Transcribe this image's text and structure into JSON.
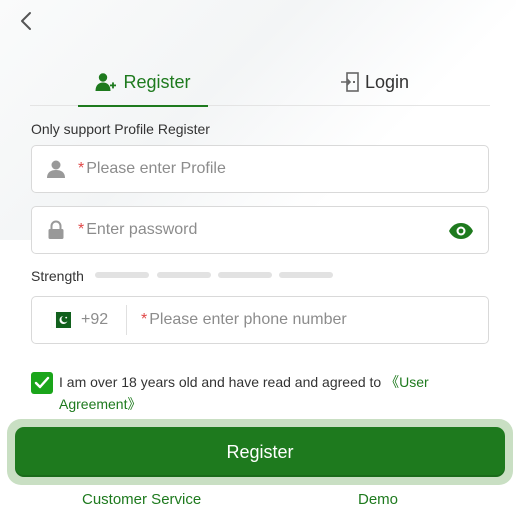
{
  "tabs": {
    "register_label": "Register",
    "login_label": "Login"
  },
  "hint": "Only support Profile Register",
  "profile": {
    "required_mark": "*",
    "placeholder": "Please enter Profile",
    "icon": "user-icon"
  },
  "password": {
    "required_mark": "*",
    "placeholder": "Enter password",
    "icon": "lock-icon",
    "toggle_icon": "eye-icon"
  },
  "strength": {
    "label": "Strength",
    "segments": 4,
    "filled": 0
  },
  "phone": {
    "country_flag": "pakistan-flag-icon",
    "country_code": "+92",
    "required_mark": "*",
    "placeholder": "Please enter phone number"
  },
  "agreement": {
    "checked": true,
    "text": "I am over 18 years old and have read and agreed to ",
    "link": "《User Agreement》"
  },
  "register_button": "Register",
  "footer": {
    "customer_service": "Customer Service",
    "demo": "Demo"
  },
  "colors": {
    "accent": "#1e7a1e",
    "checkbox": "#1aa51a",
    "required": "#e04848",
    "placeholder": "#8c8c8c"
  }
}
